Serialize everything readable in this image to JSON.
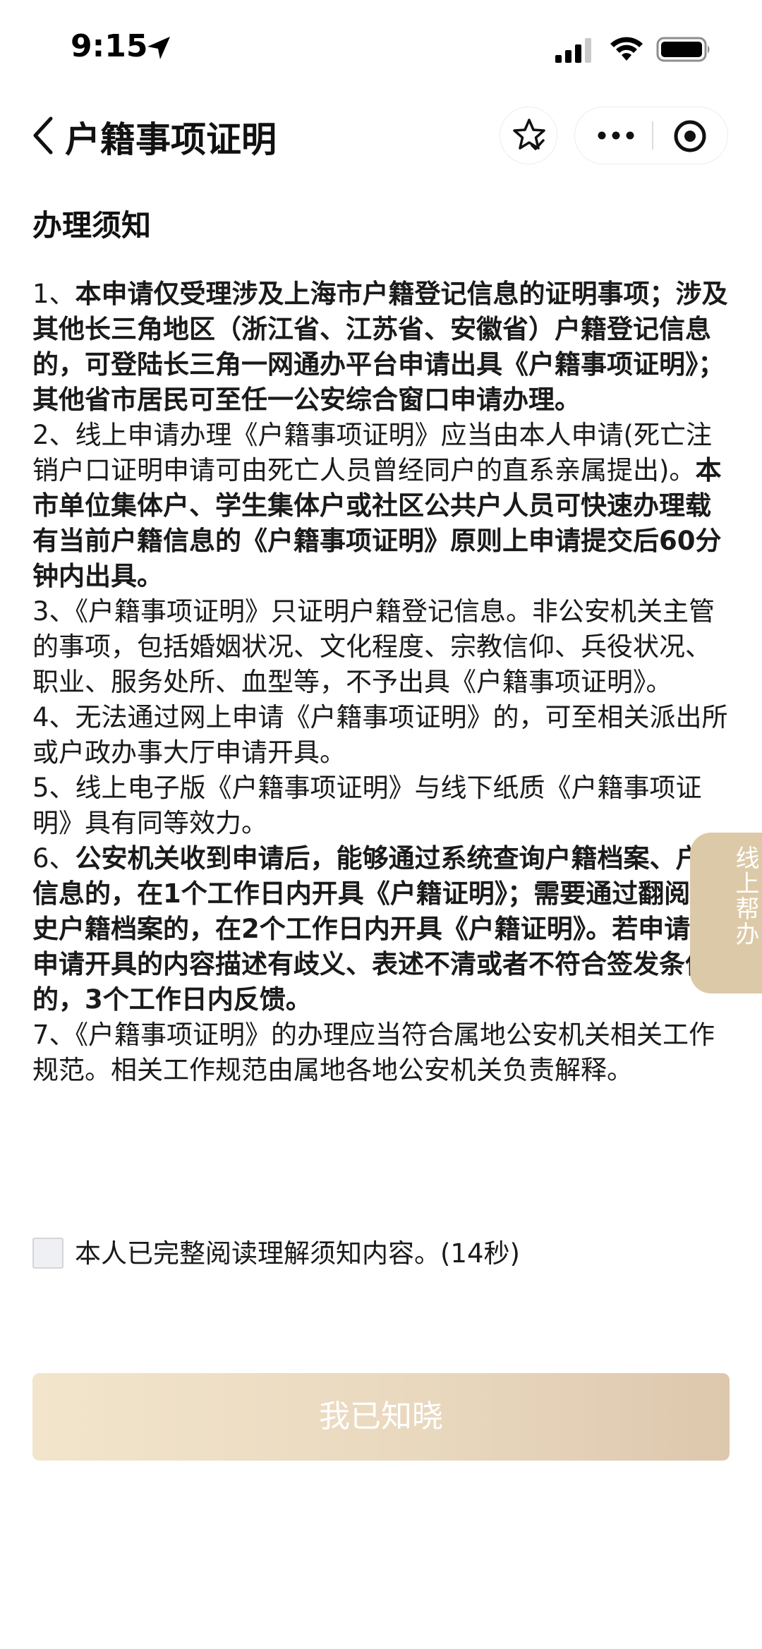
{
  "status_bar": {
    "time": "9:15",
    "icons": [
      "location-arrow-icon",
      "signal-icon",
      "wifi-icon",
      "battery-icon"
    ]
  },
  "nav": {
    "title": "户籍事项证明",
    "icons": [
      "back-chevron-icon",
      "star-check-icon",
      "more-dots-icon",
      "target-close-icon"
    ]
  },
  "notice": {
    "heading": "办理须知",
    "items": [
      {
        "segments": [
          {
            "text": "1、",
            "bold": false
          },
          {
            "text": "本申请仅受理涉及上海市户籍登记信息的证明事项；涉及其他长三角地区（浙江省、江苏省、安徽省）户籍登记信息的，可登陆长三角一网通办平台申请出具《户籍事项证明》；其他省市居民可至任一公安综合窗口申请办理。",
            "bold": true
          }
        ]
      },
      {
        "segments": [
          {
            "text": "2、线上申请办理《户籍事项证明》应当由本人申请(死亡注销户口证明申请可由死亡人员曾经同户的直系亲属提出)。",
            "bold": false
          },
          {
            "text": "本市单位集体户、学生集体户或社区公共户人员可快速办理载有当前户籍信息的《户籍事项证明》原则上申请提交后60分钟内出具。",
            "bold": true
          }
        ]
      },
      {
        "segments": [
          {
            "text": "3、《户籍事项证明》只证明户籍登记信息。非公安机关主管的事项，包括婚姻状况、文化程度、宗教信仰、兵役状况、职业、服务处所、血型等，不予出具《户籍事项证明》。",
            "bold": false
          }
        ]
      },
      {
        "segments": [
          {
            "text": "4、无法通过网上申请《户籍事项证明》的，可至相关派出所或户政办事大厅申请开具。",
            "bold": false
          }
        ]
      },
      {
        "segments": [
          {
            "text": "5、线上电子版《户籍事项证明》与线下纸质《户籍事项证明》具有同等效力。",
            "bold": false
          }
        ]
      },
      {
        "segments": [
          {
            "text": "6、",
            "bold": false
          },
          {
            "text": "公安机关收到申请后，能够通过系统查询户籍档案、户籍信息的，在1个工作日内开具《户籍证明》；需要通过翻阅历史户籍档案的，在2个工作日内开具《户籍证明》。若申请人申请开具的内容描述有歧义、表述不清或者不符合签发条件的，3个工作日内反馈。",
            "bold": true
          }
        ]
      },
      {
        "segments": [
          {
            "text": "7、《户籍事项证明》的办理应当符合属地公安机关相关工作规范。相关工作规范由属地各地公安机关负责解释。",
            "bold": false
          }
        ]
      }
    ]
  },
  "agreement": {
    "label": "本人已完整阅读理解须知内容。(14秒)",
    "checked": false
  },
  "confirm_button": {
    "label": "我已知晓",
    "enabled": false
  },
  "help_tab": {
    "label": "线上帮办"
  },
  "colors": {
    "button_gradient_start": "#f2e5cc",
    "button_gradient_end": "#ddc7ad",
    "help_tab_bg": "#dcc9a7",
    "text": "#1a1a1a"
  }
}
